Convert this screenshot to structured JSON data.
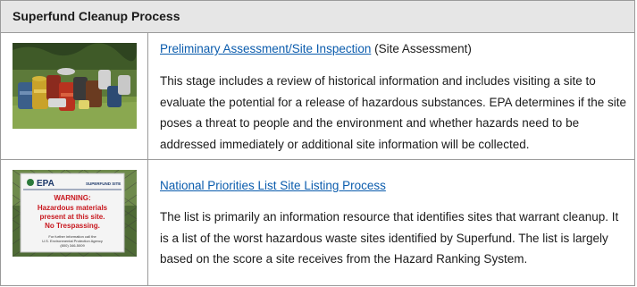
{
  "table": {
    "header_title": "Superfund Cleanup Process",
    "rows": [
      {
        "image_icon": "barrels-photo",
        "link_text": "Preliminary Assessment/Site Inspection",
        "suffix": " (Site Assessment)",
        "description": "This stage includes a review of historical information and includes visiting a site to evaluate the potential for a release of hazardous substances. EPA determines if the site poses a threat to people and the environment and whether hazards need to be addressed immediately or additional site information will be collected."
      },
      {
        "image_icon": "epa-warning-sign-photo",
        "link_text": "National Priorities List Site Listing Process",
        "description": "The list is primarily an information resource that identifies sites that warrant cleanup. It is a list of the worst hazardous waste sites identified by Superfund. The list is largely based on the score a site receives from the Hazard Ranking System."
      }
    ],
    "sign": {
      "agency": "EPA",
      "site_label": "SUPERFUND SITE",
      "warning": "WARNING:",
      "line1": "Hazardous materials",
      "line2": "present at this site.",
      "line3": "No Trespassing.",
      "fine1": "For further information call the",
      "fine2": "U.S. Environmental Protection Agency",
      "fine3": "(800) 346-5009"
    }
  },
  "colors": {
    "header_bg": "#e6e6e6",
    "link": "#0b5cad",
    "border": "#9a9a9a",
    "sign_red": "#c8171e"
  }
}
